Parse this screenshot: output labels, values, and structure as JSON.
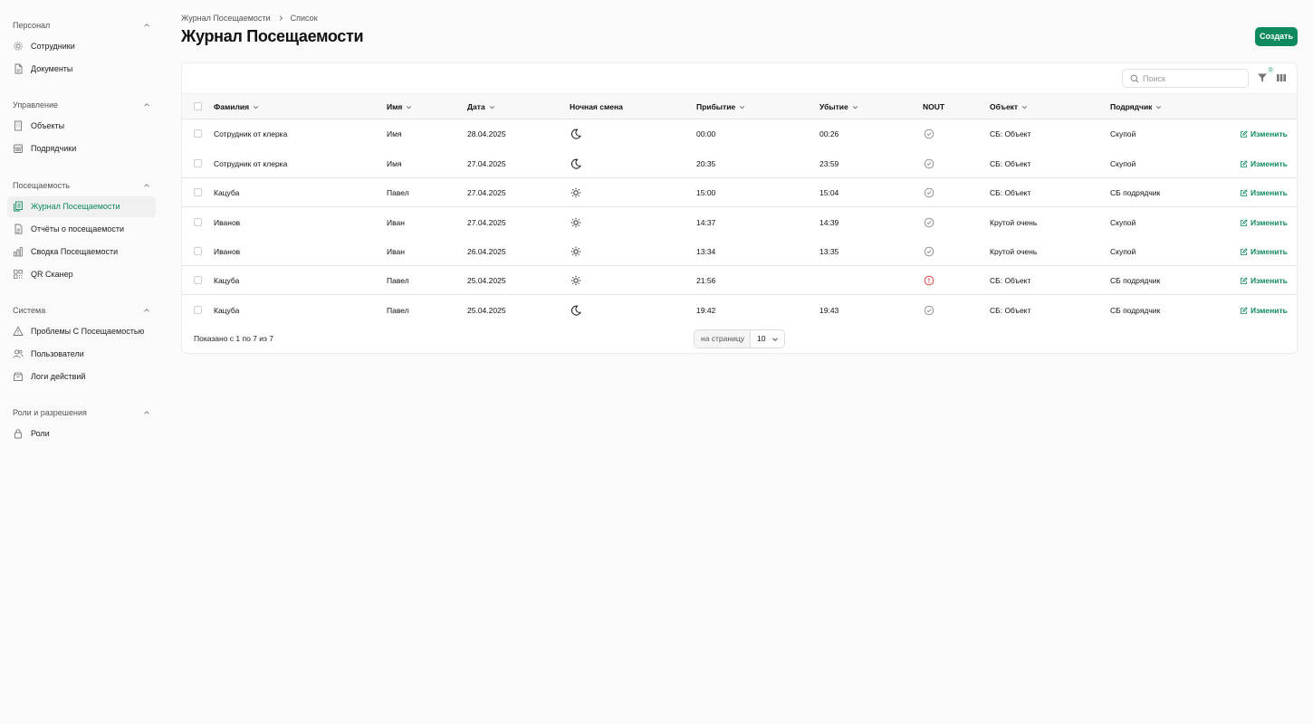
{
  "sidebar": {
    "groups": [
      {
        "title": "Персонал",
        "items": [
          {
            "label": "Сотрудники",
            "icon": "users-gear-icon"
          },
          {
            "label": "Документы",
            "icon": "document-icon"
          }
        ]
      },
      {
        "title": "Управление",
        "items": [
          {
            "label": "Объекты",
            "icon": "building-icon"
          },
          {
            "label": "Подрядчики",
            "icon": "contractor-icon"
          }
        ]
      },
      {
        "title": "Посещаемость",
        "items": [
          {
            "label": "Журнал Посещаемости",
            "icon": "journal-icon",
            "active": true
          },
          {
            "label": "Отчёты о посещаемости",
            "icon": "report-icon"
          },
          {
            "label": "Сводка Посещаемости",
            "icon": "bar-chart-icon"
          },
          {
            "label": "QR Сканер",
            "icon": "qr-icon"
          }
        ]
      },
      {
        "title": "Система",
        "items": [
          {
            "label": "Проблемы С Посещаемостью",
            "icon": "warning-icon"
          },
          {
            "label": "Пользователи",
            "icon": "users-icon"
          },
          {
            "label": "Логи действий",
            "icon": "archive-icon"
          }
        ]
      },
      {
        "title": "Роли и разрешения",
        "items": [
          {
            "label": "Роли",
            "icon": "lock-icon"
          }
        ]
      }
    ]
  },
  "breadcrumb": {
    "parent": "Журнал Посещаемости",
    "current": "Список"
  },
  "page": {
    "title": "Журнал Посещаемости",
    "create_label": "Создать"
  },
  "toolbar": {
    "search_placeholder": "Поиск",
    "filter_count": "0"
  },
  "table": {
    "columns": {
      "last_name": "Фамилия",
      "first_name": "Имя",
      "date": "Дата",
      "night_shift": "Ночная смена",
      "arrival": "Прибытие",
      "departure": "Убытие",
      "nout": "NOUT",
      "object": "Объект",
      "contractor": "Подрядчик"
    },
    "rows": [
      {
        "last_name": "Сотрудник от клерка",
        "first_name": "Имя",
        "date": "28.04.2025",
        "shift": "night",
        "arrival": "00:00",
        "departure": "00:26",
        "nout": "ok",
        "object": "СБ: Объект",
        "contractor": "Скупой",
        "edit": "Изменить"
      },
      {
        "last_name": "Сотрудник от клерка",
        "first_name": "Имя",
        "date": "27.04.2025",
        "shift": "night",
        "arrival": "20:35",
        "departure": "23:59",
        "nout": "ok",
        "object": "СБ: Объект",
        "contractor": "Скупой",
        "edit": "Изменить"
      },
      {
        "last_name": "Кацуба",
        "first_name": "Павел",
        "date": "27.04.2025",
        "shift": "day",
        "arrival": "15:00",
        "departure": "15:04",
        "nout": "ok",
        "object": "СБ: Объект",
        "contractor": "СБ подрядчик",
        "edit": "Изменить"
      },
      {
        "last_name": "Иванов",
        "first_name": "Иван",
        "date": "27.04.2025",
        "shift": "day",
        "arrival": "14:37",
        "departure": "14:39",
        "nout": "ok",
        "object": "Крутой очень",
        "contractor": "Скупой",
        "edit": "Изменить"
      },
      {
        "last_name": "Иванов",
        "first_name": "Иван",
        "date": "26.04.2025",
        "shift": "day",
        "arrival": "13:34",
        "departure": "13:35",
        "nout": "ok",
        "object": "Крутой очень",
        "contractor": "Скупой",
        "edit": "Изменить"
      },
      {
        "last_name": "Кацуба",
        "first_name": "Павел",
        "date": "25.04.2025",
        "shift": "day",
        "arrival": "21:56",
        "departure": "",
        "nout": "warning",
        "object": "СБ: Объект",
        "contractor": "СБ подрядчик",
        "edit": "Изменить"
      },
      {
        "last_name": "Кацуба",
        "first_name": "Павел",
        "date": "25.04.2025",
        "shift": "night",
        "arrival": "19:42",
        "departure": "19:43",
        "nout": "ok",
        "object": "СБ: Объект",
        "contractor": "СБ подрядчик",
        "edit": "Изменить"
      }
    ]
  },
  "footer": {
    "shown_text": "Показано с 1 по 7 из 7",
    "per_page_label": "на страницу",
    "per_page_value": "10"
  },
  "colors": {
    "accent": "#0e8a5c",
    "warning": "#d9342b"
  }
}
